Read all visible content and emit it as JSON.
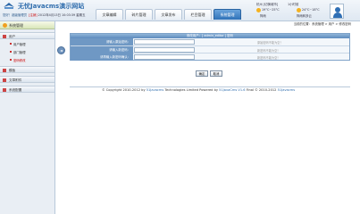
{
  "header": {
    "site_title": "无忧Javacms演示网站",
    "user": "您好！超级管理员",
    "logout": "[注销]",
    "datetime": "2012年4月13日 10:03:39 星期五",
    "weather": {
      "city": "杭州 [切换城市]",
      "city2": "1小时前",
      "today": {
        "temp": "19°C~25°C",
        "desc": "阵雨"
      },
      "tomorrow": {
        "temp": "24°C~18°C",
        "desc": "阵雨转多云"
      }
    }
  },
  "nav": {
    "tabs": [
      {
        "label": "文章编辑",
        "active": false
      },
      {
        "label": "碎片管理",
        "active": false
      },
      {
        "label": "文章发布",
        "active": false
      },
      {
        "label": "栏目管理",
        "active": false
      },
      {
        "label": "系统管理",
        "active": true
      }
    ]
  },
  "sidebar": {
    "title": "系统管理",
    "groups": [
      {
        "label": "用户",
        "items": [
          "用户管理",
          "部门管理",
          "密码修改"
        ],
        "current": "密码修改"
      },
      {
        "label": "模板"
      },
      {
        "label": "文章附件"
      },
      {
        "label": "系统配置"
      }
    ]
  },
  "breadcrumb": "当前的位置：系统管理 > 用户 > 修改密码",
  "form": {
    "title": "修改用户：[ admin_editor ] 密码",
    "rows": [
      {
        "label": "请输入原始密码：",
        "hint": "原始密码不能为空！"
      },
      {
        "label": "请输入新密码：",
        "hint": "新密码不能为空！"
      },
      {
        "label": "请再输入新密码确认：",
        "hint": "新密码不能为空！"
      }
    ],
    "submit": "确定",
    "cancel": "取消"
  },
  "footer": {
    "prefix": "© Copyright 2010-2012 by",
    "brand1": "51Javacms",
    "middle": "Technologies Limited  Powered by",
    "brand2": "51JavaCms V1.6",
    "suffix": "Final © 2010-2012",
    "brand3": "51Javacms"
  }
}
